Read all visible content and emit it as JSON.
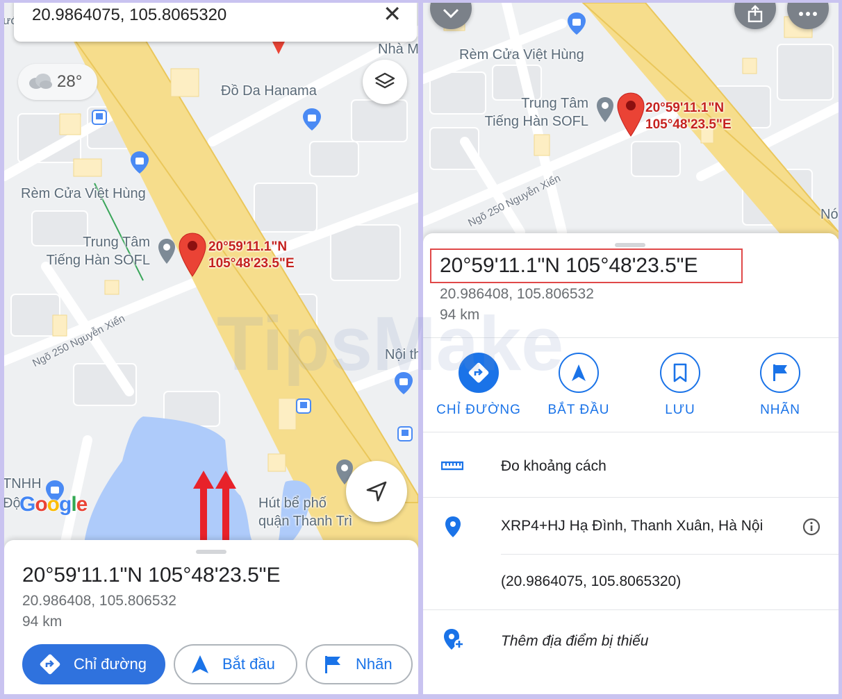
{
  "left": {
    "search": {
      "value": "20.9864075, 105.8065320",
      "close": "✕"
    },
    "weather": {
      "temp": "28°"
    },
    "map_labels": {
      "nha_m": "Nhà M",
      "do_da": "Đồ Da Hanama",
      "rem_cua": "Rèm Cửa Việt Hùng",
      "trung_tam_1": "Trung Tâm",
      "trung_tam_2": "Tiếng Hàn SOFL",
      "road": "Ngõ 250 Nguyễn Xiển",
      "noi_th": "Nội th",
      "tnhh": "TNHH",
      "do_left": "Độ",
      "hut_be_1": "Hút bể phố",
      "hut_be_2": "quận Thanh Trì",
      "uoc": "ước"
    },
    "pin": {
      "lat": "20°59'11.1\"N",
      "lng": "105°48'23.5\"E"
    },
    "google": {
      "g1": "G",
      "o1": "o",
      "o2": "o",
      "g2": "g",
      "l": "l",
      "e": "e"
    },
    "sheet": {
      "title": "20°59'11.1\"N 105°48'23.5\"E",
      "decimal": "20.986408, 105.806532",
      "distance": "94 km",
      "buttons": {
        "directions": "Chỉ đường",
        "start": "Bắt đầu",
        "label": "Nhãn"
      }
    }
  },
  "right": {
    "map_labels": {
      "rem_cua": "Rèm Cửa Việt Hùng",
      "trung_tam_1": "Trung Tâm",
      "trung_tam_2": "Tiếng Hàn SOFL",
      "road": "Ngõ 250 Nguyễn Xiển",
      "no": "Nó"
    },
    "pin": {
      "lat": "20°59'11.1\"N",
      "lng": "105°48'23.5\"E"
    },
    "sheet": {
      "title": "20°59'11.1\"N 105°48'23.5\"E",
      "decimal": "20.986408, 105.806532",
      "distance": "94 km",
      "actions": {
        "directions": "CHỈ ĐƯỜNG",
        "start": "BẮT ĐẦU",
        "save": "LƯU",
        "label": "NHÃN"
      },
      "measure": "Đo khoảng cách",
      "plus_code": "XRP4+HJ Hạ Đình, Thanh Xuân, Hà Nội",
      "coords_paren": "(20.9864075, 105.8065320)",
      "add_place": "Thêm địa điểm bị thiếu"
    }
  },
  "watermark": "TipsMake",
  "colors": {
    "accent": "#1a73e8",
    "pin": "#ea4335",
    "highway": "#f6dd8c",
    "water": "#aecbfa",
    "highlight": "#e04848",
    "arrow": "#e8222a"
  }
}
